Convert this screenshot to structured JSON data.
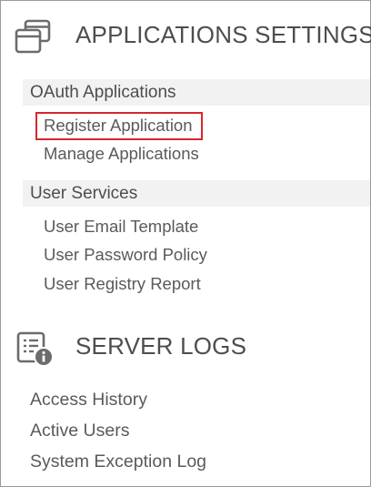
{
  "sections": {
    "applications": {
      "icon": "windows-icon",
      "title": "APPLICATIONS SETTINGS",
      "groups": {
        "oauth": {
          "label": "OAuth Applications",
          "items": [
            "Register Application",
            "Manage Applications"
          ]
        },
        "user_services": {
          "label": "User Services",
          "items": [
            "User Email Template",
            "User Password Policy",
            "User Registry Report"
          ]
        }
      }
    },
    "logs": {
      "icon": "log-info-icon",
      "title": "SERVER LOGS",
      "items": [
        "Access History",
        "Active Users",
        "System Exception Log"
      ]
    }
  },
  "colors": {
    "highlight": "#d9262b",
    "group_bg": "#f2f2f2",
    "text": "#555555",
    "icon": "#6b6b6b"
  }
}
